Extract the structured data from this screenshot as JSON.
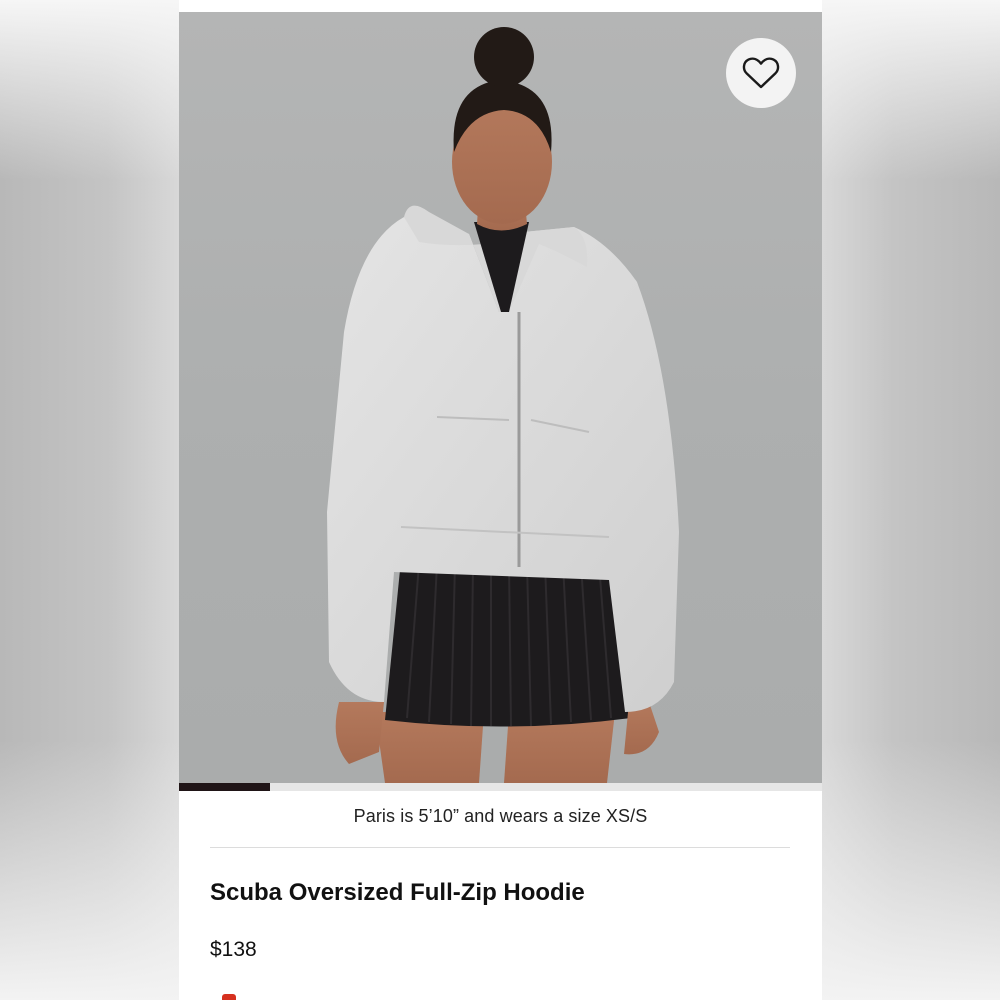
{
  "product": {
    "model_caption": "Paris is 5’10” and wears a size XS/S",
    "title": "Scuba Oversized Full-Zip Hoodie",
    "price": "$138"
  },
  "gallery": {
    "progress": 0.142
  },
  "icons": {
    "favorite": "heart-icon"
  },
  "colors": {
    "photo_background": "#adafaf",
    "progress_fill": "#1f1416",
    "accent": "#d6301f"
  }
}
